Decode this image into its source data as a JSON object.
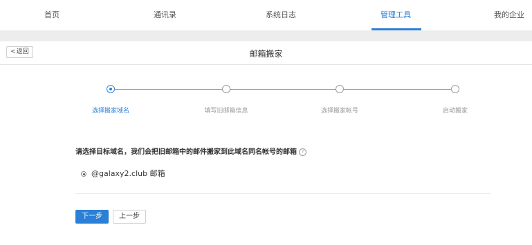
{
  "nav": {
    "items": [
      {
        "label": "首页"
      },
      {
        "label": "通讯录"
      },
      {
        "label": "系统日志"
      },
      {
        "label": "管理工具"
      },
      {
        "label": "我的企业"
      }
    ]
  },
  "titlebar": {
    "back_label": "返回",
    "title": "邮箱搬家"
  },
  "steps": [
    {
      "label": "选择搬家域名"
    },
    {
      "label": "填写旧邮箱信息"
    },
    {
      "label": "选择搬家帐号"
    },
    {
      "label": "启动搬家"
    }
  ],
  "content": {
    "instruction": "请选择目标域名，我们会把旧邮箱中的邮件搬家到此域名同名帐号的邮箱",
    "option_label": "@galaxy2.club 邮箱"
  },
  "buttons": {
    "next_label": "下一步",
    "prev_label": "上一步"
  },
  "colors": {
    "accent": "#2a7fd6",
    "band": "#ededed"
  }
}
